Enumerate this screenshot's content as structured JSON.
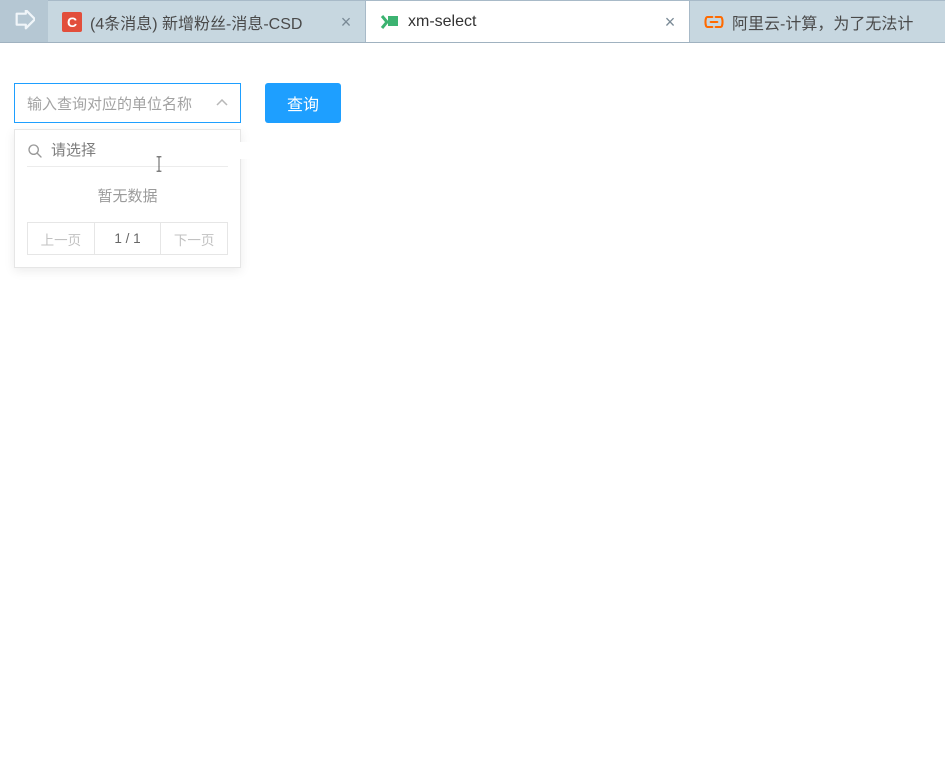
{
  "tabs": [
    {
      "favicon_text": "C",
      "title": "(4条消息) 新增粉丝-消息-CSD",
      "active": false
    },
    {
      "favicon_text": "",
      "title": "xm-select",
      "active": true
    },
    {
      "favicon_text": "",
      "title": "阿里云-计算，为了无法计",
      "active": false
    }
  ],
  "select": {
    "placeholder": "输入查询对应的单位名称"
  },
  "query_button": "查询",
  "dropdown": {
    "search_placeholder": "请选择",
    "empty_text": "暂无数据",
    "prev": "上一页",
    "page_info": "1 / 1",
    "next": "下一页"
  }
}
